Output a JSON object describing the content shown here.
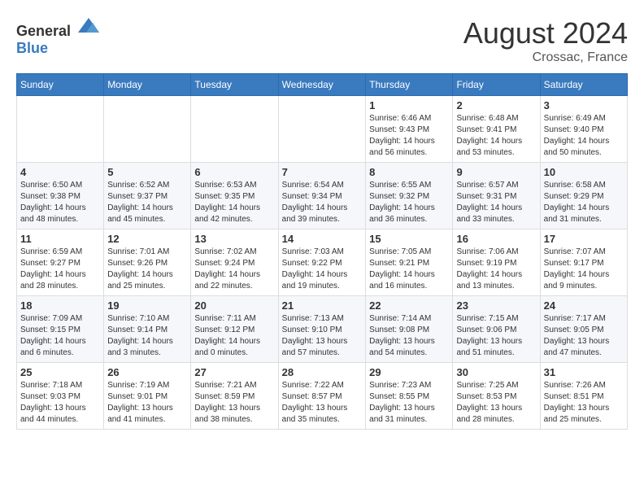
{
  "header": {
    "logo": {
      "general": "General",
      "blue": "Blue"
    },
    "month": "August 2024",
    "location": "Crossac, France"
  },
  "weekdays": [
    "Sunday",
    "Monday",
    "Tuesday",
    "Wednesday",
    "Thursday",
    "Friday",
    "Saturday"
  ],
  "weeks": [
    [
      {
        "day": "",
        "info": ""
      },
      {
        "day": "",
        "info": ""
      },
      {
        "day": "",
        "info": ""
      },
      {
        "day": "",
        "info": ""
      },
      {
        "day": "1",
        "info": "Sunrise: 6:46 AM\nSunset: 9:43 PM\nDaylight: 14 hours\nand 56 minutes."
      },
      {
        "day": "2",
        "info": "Sunrise: 6:48 AM\nSunset: 9:41 PM\nDaylight: 14 hours\nand 53 minutes."
      },
      {
        "day": "3",
        "info": "Sunrise: 6:49 AM\nSunset: 9:40 PM\nDaylight: 14 hours\nand 50 minutes."
      }
    ],
    [
      {
        "day": "4",
        "info": "Sunrise: 6:50 AM\nSunset: 9:38 PM\nDaylight: 14 hours\nand 48 minutes."
      },
      {
        "day": "5",
        "info": "Sunrise: 6:52 AM\nSunset: 9:37 PM\nDaylight: 14 hours\nand 45 minutes."
      },
      {
        "day": "6",
        "info": "Sunrise: 6:53 AM\nSunset: 9:35 PM\nDaylight: 14 hours\nand 42 minutes."
      },
      {
        "day": "7",
        "info": "Sunrise: 6:54 AM\nSunset: 9:34 PM\nDaylight: 14 hours\nand 39 minutes."
      },
      {
        "day": "8",
        "info": "Sunrise: 6:55 AM\nSunset: 9:32 PM\nDaylight: 14 hours\nand 36 minutes."
      },
      {
        "day": "9",
        "info": "Sunrise: 6:57 AM\nSunset: 9:31 PM\nDaylight: 14 hours\nand 33 minutes."
      },
      {
        "day": "10",
        "info": "Sunrise: 6:58 AM\nSunset: 9:29 PM\nDaylight: 14 hours\nand 31 minutes."
      }
    ],
    [
      {
        "day": "11",
        "info": "Sunrise: 6:59 AM\nSunset: 9:27 PM\nDaylight: 14 hours\nand 28 minutes."
      },
      {
        "day": "12",
        "info": "Sunrise: 7:01 AM\nSunset: 9:26 PM\nDaylight: 14 hours\nand 25 minutes."
      },
      {
        "day": "13",
        "info": "Sunrise: 7:02 AM\nSunset: 9:24 PM\nDaylight: 14 hours\nand 22 minutes."
      },
      {
        "day": "14",
        "info": "Sunrise: 7:03 AM\nSunset: 9:22 PM\nDaylight: 14 hours\nand 19 minutes."
      },
      {
        "day": "15",
        "info": "Sunrise: 7:05 AM\nSunset: 9:21 PM\nDaylight: 14 hours\nand 16 minutes."
      },
      {
        "day": "16",
        "info": "Sunrise: 7:06 AM\nSunset: 9:19 PM\nDaylight: 14 hours\nand 13 minutes."
      },
      {
        "day": "17",
        "info": "Sunrise: 7:07 AM\nSunset: 9:17 PM\nDaylight: 14 hours\nand 9 minutes."
      }
    ],
    [
      {
        "day": "18",
        "info": "Sunrise: 7:09 AM\nSunset: 9:15 PM\nDaylight: 14 hours\nand 6 minutes."
      },
      {
        "day": "19",
        "info": "Sunrise: 7:10 AM\nSunset: 9:14 PM\nDaylight: 14 hours\nand 3 minutes."
      },
      {
        "day": "20",
        "info": "Sunrise: 7:11 AM\nSunset: 9:12 PM\nDaylight: 14 hours\nand 0 minutes."
      },
      {
        "day": "21",
        "info": "Sunrise: 7:13 AM\nSunset: 9:10 PM\nDaylight: 13 hours\nand 57 minutes."
      },
      {
        "day": "22",
        "info": "Sunrise: 7:14 AM\nSunset: 9:08 PM\nDaylight: 13 hours\nand 54 minutes."
      },
      {
        "day": "23",
        "info": "Sunrise: 7:15 AM\nSunset: 9:06 PM\nDaylight: 13 hours\nand 51 minutes."
      },
      {
        "day": "24",
        "info": "Sunrise: 7:17 AM\nSunset: 9:05 PM\nDaylight: 13 hours\nand 47 minutes."
      }
    ],
    [
      {
        "day": "25",
        "info": "Sunrise: 7:18 AM\nSunset: 9:03 PM\nDaylight: 13 hours\nand 44 minutes."
      },
      {
        "day": "26",
        "info": "Sunrise: 7:19 AM\nSunset: 9:01 PM\nDaylight: 13 hours\nand 41 minutes."
      },
      {
        "day": "27",
        "info": "Sunrise: 7:21 AM\nSunset: 8:59 PM\nDaylight: 13 hours\nand 38 minutes."
      },
      {
        "day": "28",
        "info": "Sunrise: 7:22 AM\nSunset: 8:57 PM\nDaylight: 13 hours\nand 35 minutes."
      },
      {
        "day": "29",
        "info": "Sunrise: 7:23 AM\nSunset: 8:55 PM\nDaylight: 13 hours\nand 31 minutes."
      },
      {
        "day": "30",
        "info": "Sunrise: 7:25 AM\nSunset: 8:53 PM\nDaylight: 13 hours\nand 28 minutes."
      },
      {
        "day": "31",
        "info": "Sunrise: 7:26 AM\nSunset: 8:51 PM\nDaylight: 13 hours\nand 25 minutes."
      }
    ]
  ]
}
